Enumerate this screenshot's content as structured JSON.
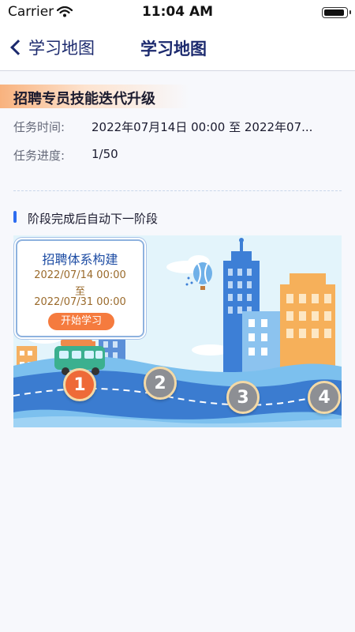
{
  "status_bar": {
    "carrier": "Carrier",
    "time": "11:04 AM"
  },
  "nav": {
    "back_label": "学习地图",
    "title": "学习地图"
  },
  "task": {
    "title": "招聘专员技能迭代升级",
    "time_label": "任务时间:",
    "time_value": "2022年07月14日 00:00 至 2022年07...",
    "progress_label": "任务进度:",
    "progress_value": "1/50"
  },
  "section": {
    "title": "阶段完成后自动下一阶段"
  },
  "stage_card": {
    "name": "招聘体系构建",
    "start_date": "2022/07/14 00:00",
    "separator": "至",
    "end_date": "2022/07/31 00:00",
    "button_label": "开始学习"
  },
  "stages": [
    {
      "number": "1",
      "state": "active"
    },
    {
      "number": "2",
      "state": "locked"
    },
    {
      "number": "3",
      "state": "locked"
    },
    {
      "number": "4",
      "state": "locked"
    }
  ],
  "colors": {
    "accent": "#2d6cf0",
    "nav_text": "#1c2a6e",
    "start_button": "#f57b3e",
    "active_node": "#ee6a38",
    "locked_node": "#8d8f94"
  },
  "icons": [
    "wifi-icon",
    "battery-icon",
    "chevron-left-icon",
    "hot-air-balloon-icon",
    "bus-icon"
  ]
}
